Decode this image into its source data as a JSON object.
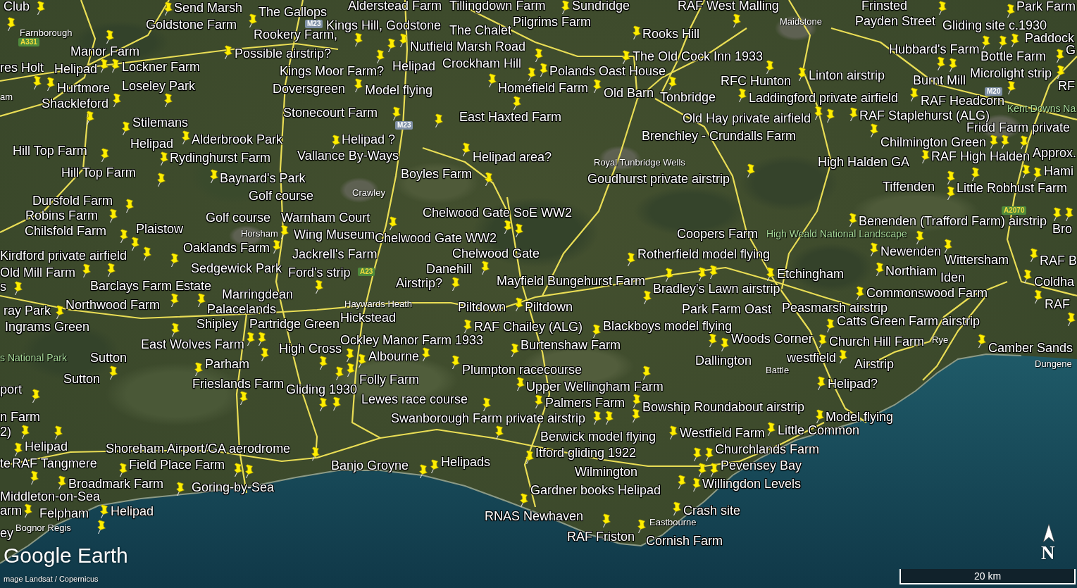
{
  "map": {
    "places": [
      {
        "label": "Club",
        "kind": "placemark"
      },
      {
        "label": "Send Marsh",
        "kind": "placemark"
      },
      {
        "label": "The Gallops",
        "kind": "placemark"
      },
      {
        "label": "Alderstead Farm",
        "kind": "placemark"
      },
      {
        "label": "Tillingdown Farm",
        "kind": "placemark"
      },
      {
        "label": "Sundridge",
        "kind": "placemark"
      },
      {
        "label": "RAF West Malling",
        "kind": "placemark"
      },
      {
        "label": "Frinsted",
        "kind": "placemark"
      },
      {
        "label": "Park Farm",
        "kind": "placemark"
      },
      {
        "label": "Goldstone Farm",
        "kind": "placemark"
      },
      {
        "label": "Kings Hill, Godstone",
        "kind": "placemark"
      },
      {
        "label": "Pilgrims Farm",
        "kind": "placemark"
      },
      {
        "label": "Maidstone",
        "kind": "town"
      },
      {
        "label": "Payden Street",
        "kind": "placemark"
      },
      {
        "label": "Gliding site c.1930",
        "kind": "placemark"
      },
      {
        "label": "Farnborough",
        "kind": "town"
      },
      {
        "label": "Rookery Farm,",
        "kind": "placemark"
      },
      {
        "label": "The Chalet",
        "kind": "placemark"
      },
      {
        "label": "Rooks Hill",
        "kind": "placemark"
      },
      {
        "label": "Paddock",
        "kind": "placemark"
      },
      {
        "label": "Manor Farm",
        "kind": "placemark"
      },
      {
        "label": "Possible airstrip?",
        "kind": "placemark"
      },
      {
        "label": "Nutfield Marsh Road",
        "kind": "placemark"
      },
      {
        "label": "The Old Cock Inn 1933",
        "kind": "placemark"
      },
      {
        "label": "Hubbard's Farm",
        "kind": "placemark"
      },
      {
        "label": "Bottle Farm",
        "kind": "placemark"
      },
      {
        "label": "G",
        "kind": "placemark"
      },
      {
        "label": "res Holt",
        "kind": "placemark"
      },
      {
        "label": "Helipad",
        "kind": "placemark"
      },
      {
        "label": "Lockner Farm",
        "kind": "placemark"
      },
      {
        "label": "Kings Moor Farm?",
        "kind": "placemark"
      },
      {
        "label": "Helipad",
        "kind": "placemark"
      },
      {
        "label": "Crockham Hill",
        "kind": "placemark"
      },
      {
        "label": "Polands Oast House",
        "kind": "placemark"
      },
      {
        "label": "Linton airstrip",
        "kind": "placemark"
      },
      {
        "label": "Microlight strip",
        "kind": "placemark"
      },
      {
        "label": "Hurtmore",
        "kind": "placemark"
      },
      {
        "label": "Loseley Park",
        "kind": "placemark"
      },
      {
        "label": "Doversgreen",
        "kind": "placemark"
      },
      {
        "label": "Model flying",
        "kind": "placemark"
      },
      {
        "label": "Homefield Farm",
        "kind": "placemark"
      },
      {
        "label": "Old Barn",
        "kind": "placemark"
      },
      {
        "label": "RFC Hunton",
        "kind": "placemark"
      },
      {
        "label": "Burnt Mill",
        "kind": "placemark"
      },
      {
        "label": "RF",
        "kind": "placemark"
      },
      {
        "label": "am",
        "kind": "town"
      },
      {
        "label": "Shackleford",
        "kind": "placemark"
      },
      {
        "label": "Tonbridge",
        "kind": "placemark"
      },
      {
        "label": "Laddingford private airfield",
        "kind": "placemark"
      },
      {
        "label": "RAF Headcorn",
        "kind": "placemark"
      },
      {
        "label": "Kent Downs Na",
        "kind": "park"
      },
      {
        "label": "Stilemans",
        "kind": "placemark"
      },
      {
        "label": "Stonecourt Farm",
        "kind": "placemark"
      },
      {
        "label": "East Haxted Farm",
        "kind": "placemark"
      },
      {
        "label": "Old Hay private airfield",
        "kind": "placemark"
      },
      {
        "label": "RAF Staplehurst (ALG)",
        "kind": "placemark"
      },
      {
        "label": "Fridd Farm private",
        "kind": "placemark"
      },
      {
        "label": "Helipad",
        "kind": "placemark"
      },
      {
        "label": "Alderbrook Park",
        "kind": "placemark"
      },
      {
        "label": "Helipad ?",
        "kind": "placemark"
      },
      {
        "label": "Brenchley - Crundalls Farm",
        "kind": "placemark"
      },
      {
        "label": "Chilmington Green",
        "kind": "placemark"
      },
      {
        "label": "Hill Top Farm",
        "kind": "placemark"
      },
      {
        "label": "Rydinghurst Farm",
        "kind": "placemark"
      },
      {
        "label": "Vallance By-Ways",
        "kind": "placemark"
      },
      {
        "label": "Helipad area?",
        "kind": "placemark"
      },
      {
        "label": "Royal Tunbridge Wells",
        "kind": "town"
      },
      {
        "label": "High Halden GA",
        "kind": "placemark"
      },
      {
        "label": "RAF High Halden",
        "kind": "placemark"
      },
      {
        "label": "Approx.",
        "kind": "placemark"
      },
      {
        "label": "Hill Top Farm",
        "kind": "placemark"
      },
      {
        "label": "Baynard's Park",
        "kind": "placemark"
      },
      {
        "label": "Boyles Farm",
        "kind": "placemark"
      },
      {
        "label": "Goudhurst private airstrip",
        "kind": "placemark"
      },
      {
        "label": "Tiffenden",
        "kind": "placemark"
      },
      {
        "label": "Little Robhust Farm",
        "kind": "placemark"
      },
      {
        "label": "Hami",
        "kind": "placemark"
      },
      {
        "label": "Dursfold Farm",
        "kind": "placemark"
      },
      {
        "label": "Golf course",
        "kind": "placemark"
      },
      {
        "label": "Crawley",
        "kind": "town"
      },
      {
        "label": "Robins Farm",
        "kind": "placemark"
      },
      {
        "label": "Golf course",
        "kind": "placemark"
      },
      {
        "label": "Warnham Court",
        "kind": "placemark"
      },
      {
        "label": "Chelwood Gate SoE WW2",
        "kind": "placemark"
      },
      {
        "label": "Benenden (Trafford Farm) airstrip",
        "kind": "placemark"
      },
      {
        "label": "Chilsfold Farm",
        "kind": "placemark"
      },
      {
        "label": "Plaistow",
        "kind": "placemark"
      },
      {
        "label": "Horsham",
        "kind": "town"
      },
      {
        "label": "Wing Museum",
        "kind": "placemark"
      },
      {
        "label": "Chelwood Gate WW2",
        "kind": "placemark"
      },
      {
        "label": "Coopers Farm",
        "kind": "placemark"
      },
      {
        "label": "High Weald National Landscape",
        "kind": "park"
      },
      {
        "label": "Bro",
        "kind": "placemark"
      },
      {
        "label": "Kirdford private airfield",
        "kind": "placemark"
      },
      {
        "label": "Oaklands Farm",
        "kind": "placemark"
      },
      {
        "label": "Jackrell's Farm",
        "kind": "placemark"
      },
      {
        "label": "Chelwood Gate",
        "kind": "placemark"
      },
      {
        "label": "Rotherfield model flying",
        "kind": "placemark"
      },
      {
        "label": "Newenden",
        "kind": "placemark"
      },
      {
        "label": "Wittersham",
        "kind": "placemark"
      },
      {
        "label": "RAF B",
        "kind": "placemark"
      },
      {
        "label": "Old Mill Farm",
        "kind": "placemark"
      },
      {
        "label": "Sedgewick Park",
        "kind": "placemark"
      },
      {
        "label": "Ford's strip",
        "kind": "placemark"
      },
      {
        "label": "Danehill",
        "kind": "placemark"
      },
      {
        "label": "Etchingham",
        "kind": "placemark"
      },
      {
        "label": "Northiam",
        "kind": "placemark"
      },
      {
        "label": "Iden",
        "kind": "placemark"
      },
      {
        "label": "s",
        "kind": "placemark"
      },
      {
        "label": "Barclays Farm Estate",
        "kind": "placemark"
      },
      {
        "label": "Airstrip?",
        "kind": "placemark"
      },
      {
        "label": "Mayfield Bungehurst Farm",
        "kind": "placemark"
      },
      {
        "label": "Bradley's Lawn airstrip",
        "kind": "placemark"
      },
      {
        "label": "Coldha",
        "kind": "placemark"
      },
      {
        "label": "Marringdean",
        "kind": "placemark"
      },
      {
        "label": "Commonswood Farm",
        "kind": "placemark"
      },
      {
        "label": "ray Park",
        "kind": "placemark"
      },
      {
        "label": "Northwood Farm",
        "kind": "placemark"
      },
      {
        "label": "Palacelands",
        "kind": "placemark"
      },
      {
        "label": "Haywards Heath",
        "kind": "town"
      },
      {
        "label": "Piltdown",
        "kind": "placemark"
      },
      {
        "label": "Piltdown",
        "kind": "placemark"
      },
      {
        "label": "Park Farm Oast",
        "kind": "placemark"
      },
      {
        "label": "Peasmarsh airstrip",
        "kind": "placemark"
      },
      {
        "label": "RAF",
        "kind": "placemark"
      },
      {
        "label": "Ingrams Green",
        "kind": "placemark"
      },
      {
        "label": "Shipley",
        "kind": "placemark"
      },
      {
        "label": "Partridge Green",
        "kind": "placemark"
      },
      {
        "label": "Hickstead",
        "kind": "placemark"
      },
      {
        "label": "RAF Chailey (ALG)",
        "kind": "placemark"
      },
      {
        "label": "Blackboys model flying",
        "kind": "placemark"
      },
      {
        "label": "Catts Green Farm airstrip",
        "kind": "placemark"
      },
      {
        "label": "East Wolves Farm",
        "kind": "placemark"
      },
      {
        "label": "High Cross",
        "kind": "placemark"
      },
      {
        "label": "Ockley Manor Farm 1933",
        "kind": "placemark"
      },
      {
        "label": "Burtenshaw Farm",
        "kind": "placemark"
      },
      {
        "label": "Woods Corner",
        "kind": "placemark"
      },
      {
        "label": "Church Hill Farm",
        "kind": "placemark"
      },
      {
        "label": "Rye",
        "kind": "town"
      },
      {
        "label": "Camber Sands",
        "kind": "placemark"
      },
      {
        "label": "s National Park",
        "kind": "park"
      },
      {
        "label": "Sutton",
        "kind": "placemark"
      },
      {
        "label": "Parham",
        "kind": "placemark"
      },
      {
        "label": "Albourne",
        "kind": "placemark"
      },
      {
        "label": "Plumpton racecourse",
        "kind": "placemark"
      },
      {
        "label": "Dallington",
        "kind": "placemark"
      },
      {
        "label": "Battle",
        "kind": "town"
      },
      {
        "label": "westfield",
        "kind": "placemark"
      },
      {
        "label": "Airstrip",
        "kind": "placemark"
      },
      {
        "label": "Dungene",
        "kind": "town"
      },
      {
        "label": "port",
        "kind": "placemark"
      },
      {
        "label": "Sutton",
        "kind": "placemark"
      },
      {
        "label": "Frieslands Farm",
        "kind": "placemark"
      },
      {
        "label": "Gliding 1930",
        "kind": "placemark"
      },
      {
        "label": "Folly Farm",
        "kind": "placemark"
      },
      {
        "label": "Upper Wellingham Farm",
        "kind": "placemark"
      },
      {
        "label": "Helipad?",
        "kind": "placemark"
      },
      {
        "label": "Lewes race course",
        "kind": "placemark"
      },
      {
        "label": "Palmers Farm",
        "kind": "placemark"
      },
      {
        "label": "Bowship Roundabout airstrip",
        "kind": "placemark"
      },
      {
        "label": "n Farm",
        "kind": "placemark"
      },
      {
        "label": "Swanborough Farm private airstrip",
        "kind": "placemark"
      },
      {
        "label": "Model flying",
        "kind": "placemark"
      },
      {
        "label": "2)",
        "kind": "placemark"
      },
      {
        "label": "Berwick model flying",
        "kind": "placemark"
      },
      {
        "label": "Westfield Farm",
        "kind": "placemark"
      },
      {
        "label": "Little Common",
        "kind": "placemark"
      },
      {
        "label": "Helipad",
        "kind": "placemark"
      },
      {
        "label": "Shoreham Airport/GA aerodrome",
        "kind": "placemark"
      },
      {
        "label": "Itford gliding 1922",
        "kind": "placemark"
      },
      {
        "label": "Churchlands Farm",
        "kind": "placemark"
      },
      {
        "label": "te",
        "kind": "placemark"
      },
      {
        "label": "RAF Tangmere",
        "kind": "placemark"
      },
      {
        "label": "Field Place Farm",
        "kind": "placemark"
      },
      {
        "label": "Banjo Groyne",
        "kind": "placemark"
      },
      {
        "label": "Helipads",
        "kind": "placemark"
      },
      {
        "label": "Wilmington",
        "kind": "placemark"
      },
      {
        "label": "Pevensey Bay",
        "kind": "placemark"
      },
      {
        "label": "Broadmark Farm",
        "kind": "placemark"
      },
      {
        "label": "Goring-by-Sea",
        "kind": "placemark"
      },
      {
        "label": "Gardner books Helipad",
        "kind": "placemark"
      },
      {
        "label": "Willingdon Levels",
        "kind": "placemark"
      },
      {
        "label": "Middleton-on-Sea",
        "kind": "placemark"
      },
      {
        "label": "arm",
        "kind": "placemark"
      },
      {
        "label": "Felpham",
        "kind": "placemark"
      },
      {
        "label": "Helipad",
        "kind": "placemark"
      },
      {
        "label": "RNAS Newhaven",
        "kind": "placemark"
      },
      {
        "label": "Crash site",
        "kind": "placemark"
      },
      {
        "label": "Bognor Regis",
        "kind": "town"
      },
      {
        "label": "Eastbourne",
        "kind": "town"
      },
      {
        "label": "ey",
        "kind": "placemark"
      },
      {
        "label": "RAF Friston",
        "kind": "placemark"
      },
      {
        "label": "Cornish Farm",
        "kind": "placemark"
      }
    ],
    "road_shields": [
      {
        "label": "M23",
        "kind": "motorway"
      },
      {
        "label": "A331",
        "kind": "a_road"
      },
      {
        "label": "M20",
        "kind": "motorway"
      },
      {
        "label": "M23",
        "kind": "motorway"
      },
      {
        "label": "A2070",
        "kind": "a_road"
      },
      {
        "label": "A23",
        "kind": "a_road"
      }
    ]
  },
  "compass": {
    "label": "N"
  },
  "scale_bar": {
    "label": "20 km"
  },
  "logo": {
    "label": "Google Earth"
  },
  "attribution": {
    "label": "mage Landsat / Copernicus"
  }
}
